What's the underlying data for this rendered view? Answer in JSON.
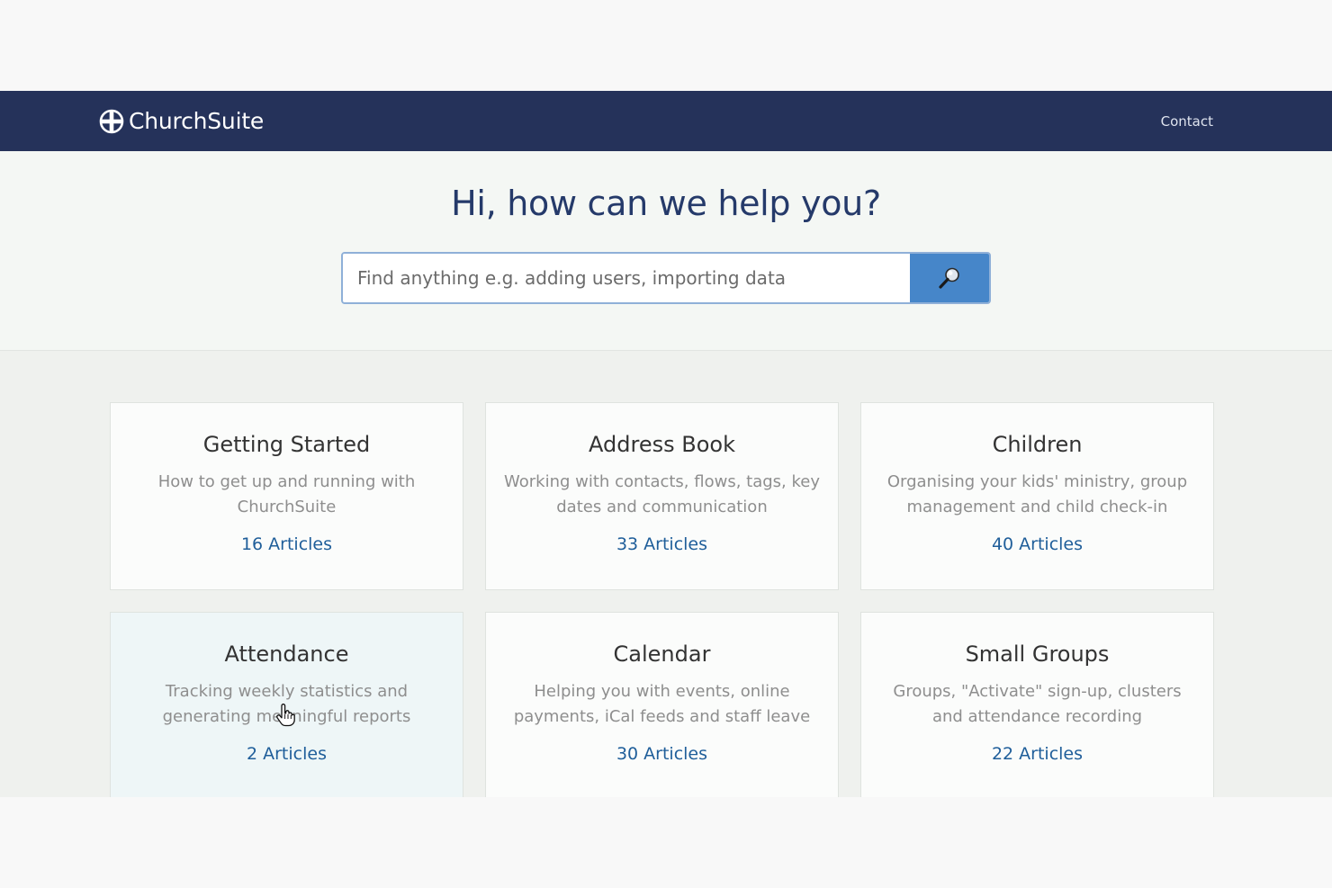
{
  "navbar": {
    "brand": "ChurchSuite",
    "contact": "Contact"
  },
  "hero": {
    "title": "Hi, how can we help you?",
    "search_placeholder": "Find anything e.g. adding users, importing data"
  },
  "categories": [
    {
      "title": "Getting Started",
      "description": "How to get up and running with ChurchSuite",
      "articles": "16 Articles"
    },
    {
      "title": "Address Book",
      "description": "Working with contacts, flows, tags, key dates and communication",
      "articles": "33 Articles"
    },
    {
      "title": "Children",
      "description": "Organising your kids' ministry, group management and child check-in",
      "articles": "40 Articles"
    },
    {
      "title": "Attendance",
      "description": "Tracking weekly statistics and generating meaningful reports",
      "articles": "2 Articles"
    },
    {
      "title": "Calendar",
      "description": "Helping you with events, online payments, iCal feeds and staff leave",
      "articles": "30 Articles"
    },
    {
      "title": "Small Groups",
      "description": "Groups, \"Activate\" sign-up, clusters and attendance recording",
      "articles": "22 Articles"
    }
  ],
  "colors": {
    "navbar": "#25325a",
    "accent": "#4686c9",
    "link": "#1f5e9a",
    "title": "#253a6a"
  }
}
